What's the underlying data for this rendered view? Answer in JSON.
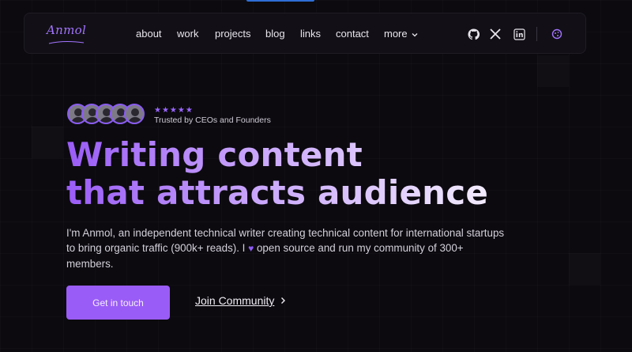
{
  "brand": {
    "logo_text": "Anmol",
    "accent": "#9a5cf6"
  },
  "nav": {
    "items": [
      {
        "label": "about"
      },
      {
        "label": "work"
      },
      {
        "label": "projects"
      },
      {
        "label": "blog"
      },
      {
        "label": "links"
      },
      {
        "label": "contact"
      },
      {
        "label": "more"
      }
    ],
    "icons": [
      "github-icon",
      "x-twitter-icon",
      "linkedin-icon",
      "theme-toggle-icon"
    ]
  },
  "hero": {
    "rating_stars": "★★★★★",
    "trusted_text": "Trusted by CEOs and Founders",
    "headline_line1": "Writing content",
    "headline_line2": "that attracts audience",
    "description_part1": "I'm Anmol, an independent technical writer creating technical content for international startups to bring organic traffic (900k+ reads). I",
    "description_part2": " open source and run my community of 300+ members.",
    "primary_cta": "Get in touch",
    "secondary_cta": "Join Community"
  }
}
